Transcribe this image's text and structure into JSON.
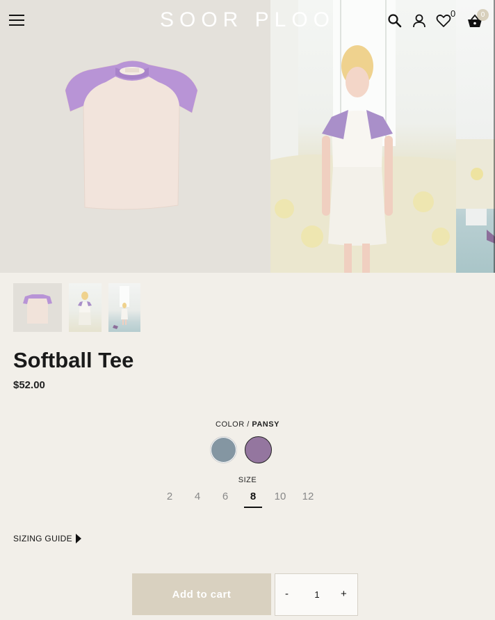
{
  "header": {
    "logo": "SOOR PLOO",
    "wishlist_count": "0",
    "cart_count": "0"
  },
  "gallery": {
    "images": [
      "tee-flat-lay",
      "girl-wearing-tee",
      "room-scene"
    ],
    "thumbnails": [
      "tee-flat-lay",
      "girl-wearing-tee",
      "room-scene"
    ]
  },
  "product": {
    "title": "Softball Tee",
    "price": "$52.00"
  },
  "color": {
    "label": "COLOR / ",
    "selected": "PANSY",
    "swatches": [
      {
        "name": "slate",
        "hex": "#8496a2"
      },
      {
        "name": "pansy",
        "hex": "#94769f"
      }
    ]
  },
  "size": {
    "label": "SIZE",
    "options": [
      "2",
      "4",
      "6",
      "8",
      "10",
      "12"
    ],
    "selected": "8"
  },
  "sizing_guide": "SIZING GUIDE",
  "cart": {
    "add_label": "Add to cart",
    "minus": "-",
    "quantity": "1",
    "plus": "+"
  }
}
